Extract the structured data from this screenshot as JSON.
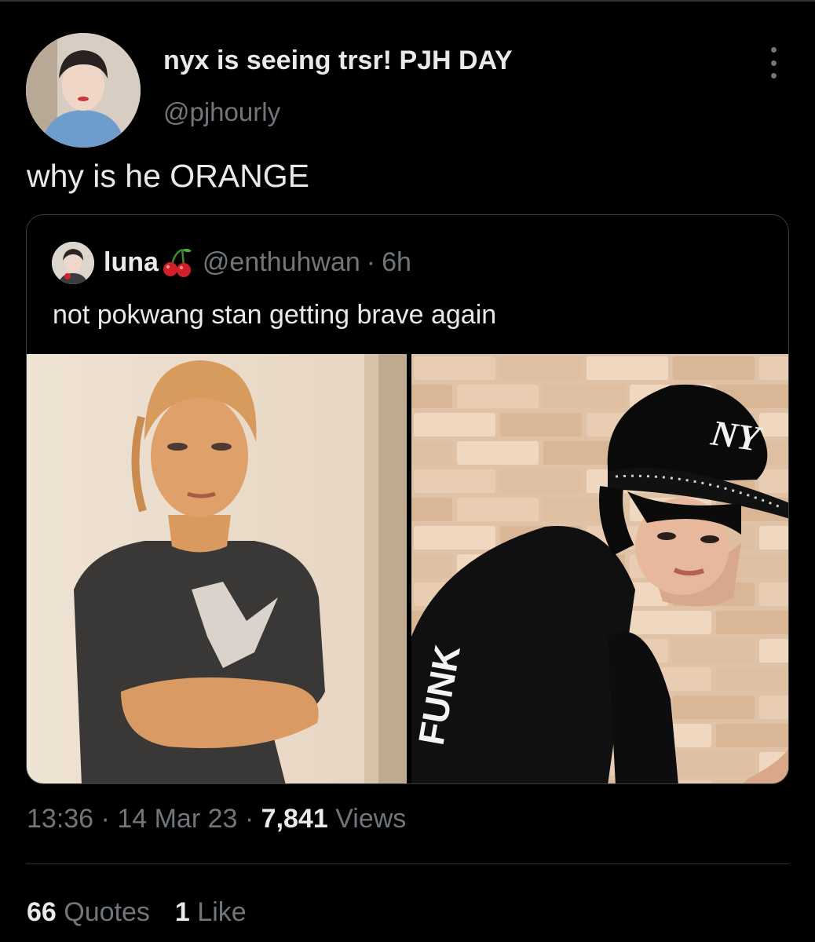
{
  "tweet": {
    "author": {
      "display_name": "nyx is seeing trsr! PJH DAY",
      "handle": "@pjhourly"
    },
    "text": "why is he ORANGE",
    "quoted": {
      "author_name": "luna",
      "emoji": "cherries-emoji",
      "handle": "@enthuhwan",
      "separator": "·",
      "time": "6h",
      "text": "not pokwang stan getting brave again",
      "image_text": {
        "cap_logo": "NY",
        "shirt_print": "FUNK"
      }
    },
    "meta": {
      "time": "13:36",
      "date": "14 Mar 23",
      "separator": "·",
      "views_count": "7,841",
      "views_label": "Views"
    },
    "stats": {
      "quotes_count": "66",
      "quotes_label": "Quotes",
      "likes_count": "1",
      "likes_label": "Like"
    }
  },
  "icons": {
    "more": "more-dots-icon"
  },
  "colors": {
    "background": "#000000",
    "text_primary": "#e7e9ea",
    "text_secondary": "#71767b",
    "border": "#2f3336"
  }
}
